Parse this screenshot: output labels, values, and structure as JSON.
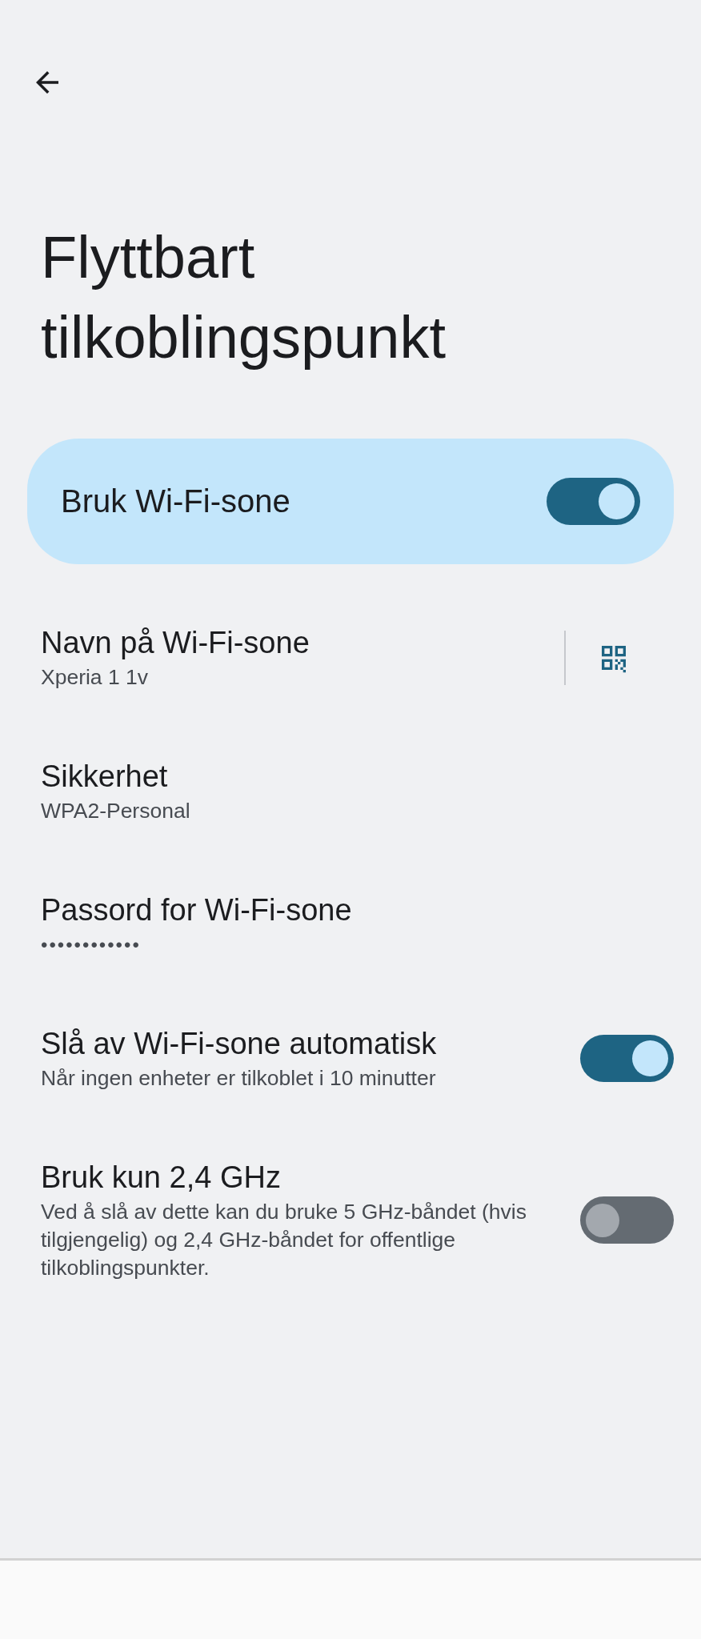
{
  "title": "Flyttbart tilkoblingspunkt",
  "main_switch": {
    "label": "Bruk Wi-Fi-sone",
    "on": true
  },
  "settings": [
    {
      "kind": "qr",
      "title": "Navn på Wi-Fi-sone",
      "summary": "Xperia 1 1v"
    },
    {
      "kind": "text",
      "title": "Sikkerhet",
      "summary": "WPA2-Personal"
    },
    {
      "kind": "password",
      "title": "Passord for Wi-Fi-sone",
      "summary": "••••••••••••"
    },
    {
      "kind": "switch",
      "title": "Slå av Wi-Fi-sone automatisk",
      "summary": "Når ingen enheter er tilkoblet i 10 minutter",
      "on": true
    },
    {
      "kind": "switch",
      "title": "Bruk kun 2,4 GHz",
      "summary": "Ved å slå av dette kan du bruke 5 GHz-båndet (hvis tilgjengelig) og 2,4 GHz-båndet for offentlige tilkoblingspunkter.",
      "on": false
    }
  ]
}
